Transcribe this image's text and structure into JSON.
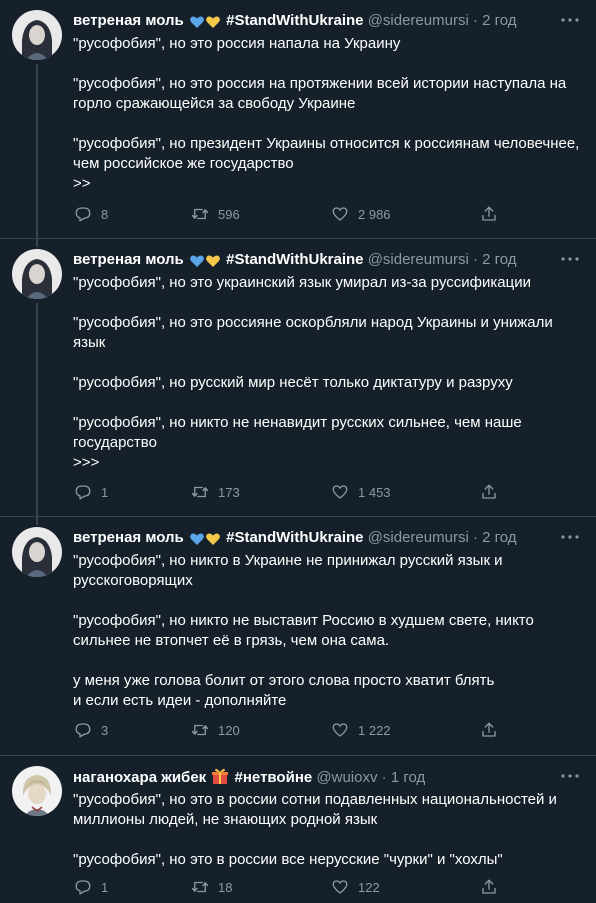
{
  "colors": {
    "background": "#15202b",
    "text": "#ffffff",
    "secondary": "#8b98a5",
    "divider": "#38444d",
    "heart_blue": "#5aa5e8",
    "heart_yellow": "#f5c74a"
  },
  "tweets": [
    {
      "name": "ветреная моль",
      "emoji": [
        "blue-heart-icon",
        "yellow-heart-icon"
      ],
      "tag": "#StandWithUkraine",
      "handle": "@sidereumursi",
      "dot": "·",
      "time": "2 год",
      "paragraphs": [
        "\"русофобия\", но это россия напала на Украину",
        "\"русофобия\", но это россия на протяжении всей истории наступала на горло сражающейся за свободу Украине",
        "\"русофобия\", но президент Украины относится к россиянам человечнее, чем российское же государство\n>>"
      ],
      "replies": "8",
      "retweets": "596",
      "likes": "2 986"
    },
    {
      "name": "ветреная моль",
      "emoji": [
        "blue-heart-icon",
        "yellow-heart-icon"
      ],
      "tag": "#StandWithUkraine",
      "handle": "@sidereumursi",
      "dot": "·",
      "time": "2 год",
      "paragraphs": [
        "\"русофобия\", но это украинский язык умирал из-за руссификации",
        "\"русофобия\", но это россияне оскорбляли народ Украины и унижали язык",
        "\"русофобия\", но русский мир несёт только диктатуру и разруху",
        "\"русофобия\", но никто не ненавидит русских сильнее, чем наше государство\n>>>"
      ],
      "replies": "1",
      "retweets": "173",
      "likes": "1 453"
    },
    {
      "name": "ветреная моль",
      "emoji": [
        "blue-heart-icon",
        "yellow-heart-icon"
      ],
      "tag": "#StandWithUkraine",
      "handle": "@sidereumursi",
      "dot": "·",
      "time": "2 год",
      "paragraphs": [
        "\"русофобия\", но никто в Украине не принижал русский язык и русскоговорящих",
        "\"русофобия\", но никто не выставит Россию в худшем свете, никто сильнее не втопчет её в грязь, чем она сама.",
        "у меня уже голова болит от этого слова просто хватит блять\nи если есть идеи - дополняйте"
      ],
      "replies": "3",
      "retweets": "120",
      "likes": "1 222"
    },
    {
      "name": "наганохара жибек",
      "emoji": [
        "gift-icon"
      ],
      "tag": "#нетвойне",
      "handle": "@wuioxv",
      "dot": "·",
      "time": "1 год",
      "paragraphs": [
        "\"русофобия\", но это в россии сотни подавленных национальностей и миллионы людей, не знающих родной язык",
        "\"русофобия\", но это в россии все нерусские \"чурки\" и \"хохлы\""
      ],
      "replies": "1",
      "retweets": "18",
      "likes": "122"
    }
  ]
}
